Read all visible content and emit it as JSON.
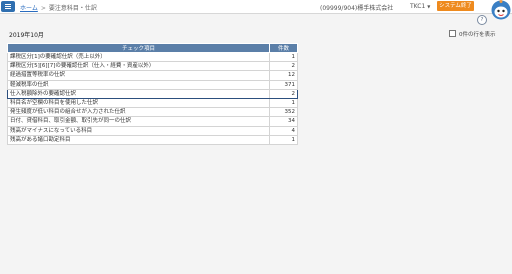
{
  "header": {
    "menu_icon": "hamburger-menu-icon",
    "breadcrumb": {
      "home": "ホーム",
      "separator": ">",
      "current": "要注意科目・仕訳"
    },
    "company": "(09999/904)標手株式会社",
    "user": "TKC1",
    "user_caret": "▼",
    "exit_button": "システム終了",
    "help_label": "?"
  },
  "filters": {
    "period": "2019年10月",
    "show_zero_label": "0件の行を表示",
    "show_zero_checked": false
  },
  "table": {
    "columns": [
      "チェック項目",
      "件数"
    ],
    "rows": [
      {
        "item": "課税区分[1]の要確認仕訳（売上以外）",
        "count": "1"
      },
      {
        "item": "課税区分[5][6][7]の要確認仕訳（仕入・経費・資産以外）",
        "count": "2"
      },
      {
        "item": "経過措置等税率の仕訳",
        "count": "12"
      },
      {
        "item": "軽減税率の仕訳",
        "count": "371"
      },
      {
        "item": "仕入税額除外の要確認仕訳",
        "count": "2",
        "selected": true
      },
      {
        "item": "科目名が空欄の科目を使用した仕訳",
        "count": "1"
      },
      {
        "item": "発生頻度が低い科目の組合せが入力された仕訳",
        "count": "352"
      },
      {
        "item": "日付、貸借科目、取引金額、取引先が同一の仕訳",
        "count": "34"
      },
      {
        "item": "残高がマイナスになっている科目",
        "count": "4"
      },
      {
        "item": "残高がある諸口勘定科目",
        "count": "1"
      }
    ]
  },
  "colors": {
    "header_blue": "#5b7fa8",
    "exit_orange": "#ee8a1e",
    "link_blue": "#2a6cbf"
  }
}
